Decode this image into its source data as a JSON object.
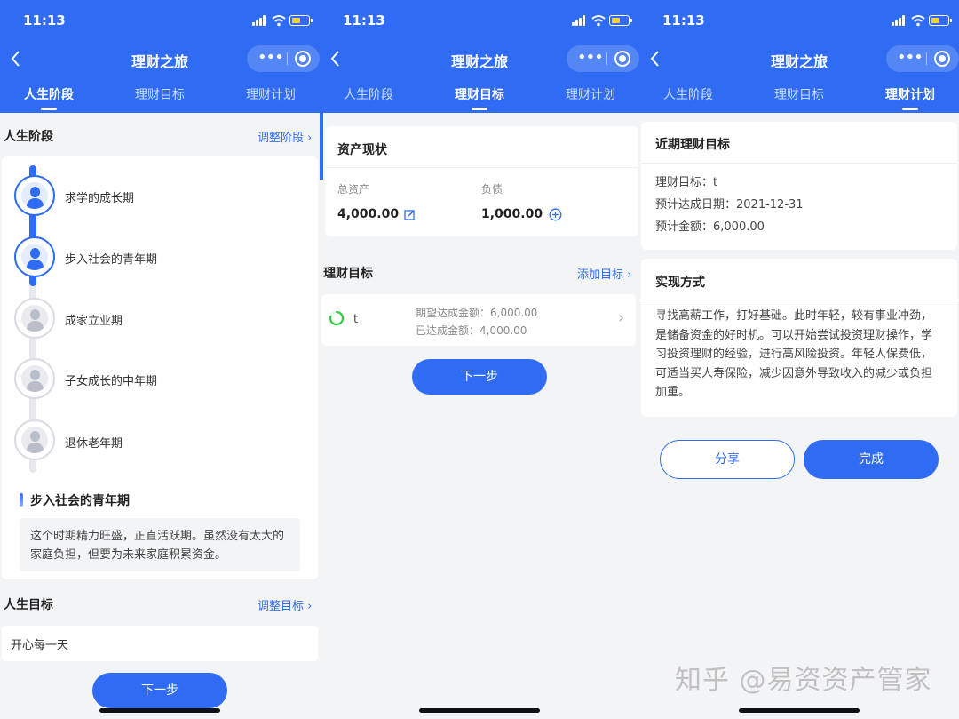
{
  "status": {
    "time": "11:13"
  },
  "app": {
    "title": "理财之旅",
    "tabs": [
      "人生阶段",
      "理财目标",
      "理财计划"
    ],
    "capsule_dots": "•••"
  },
  "screen1": {
    "life_stage_title": "人生阶段",
    "adjust_stage": "调整阶段",
    "stages": [
      "求学的成长期",
      "步入社会的青年期",
      "成家立业期",
      "子女成长的中年期",
      "退休老年期"
    ],
    "current_stage_title": "步入社会的青年期",
    "current_stage_desc": "这个时期精力旺盛，正直活跃期。虽然没有太大的家庭负担，但要为未来家庭积累资金。",
    "life_goal_title": "人生目标",
    "adjust_goal": "调整目标",
    "life_goal_value": "开心每一天",
    "next_button": "下一步"
  },
  "screen2": {
    "assets_title": "资产现状",
    "total_assets_label": "总资产",
    "total_assets_value": "4,000.00",
    "liabilities_label": "负债",
    "liabilities_value": "1,000.00",
    "goals_title": "理财目标",
    "add_goal": "添加目标",
    "goal_name": "t",
    "expected_amount": "期望达成金额：6,000.00",
    "achieved_amount": "已达成金额：4,000.00",
    "next_button": "下一步"
  },
  "screen3": {
    "recent_goal_title": "近期理财目标",
    "goal_line": "理财目标：t",
    "date_line": "预计达成日期：2021-12-31",
    "amount_line": "预计金额：6,000.00",
    "method_title": "实现方式",
    "method_text": "寻找高薪工作，打好基础。此时年轻，较有事业冲劲，是储备资金的好时机。可以开始尝试投资理财操作，学习投资理财的经验，进行高风险投资。年轻人保费低，可适当买人寿保险，减少因意外导致收入的减少或负担加重。",
    "share_button": "分享",
    "done_button": "完成"
  },
  "watermark": "知乎 @易资资产管家",
  "colors": {
    "brand": "#2f6cf3",
    "background": "#f3f4f6",
    "battery": "#f7d13b",
    "progress": "#2ecc40"
  }
}
